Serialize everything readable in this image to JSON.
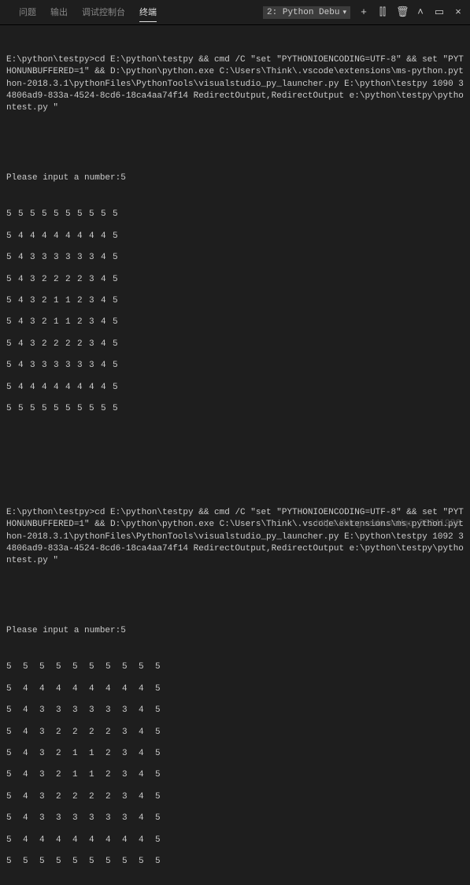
{
  "header": {
    "tabs": {
      "problems": "问题",
      "output": "输出",
      "debug_console": "调试控制台",
      "terminal": "终端"
    },
    "active_tab": "terminal",
    "dropdown_label": "2: Python Debu",
    "icons": {
      "plus": "+",
      "split": "⫿⫿",
      "trash": "🗑",
      "up": "˄",
      "maximize": "▭",
      "close": "×"
    }
  },
  "run1": {
    "cmd_line1": "E:\\python\\testpy>cd E:\\python\\testpy && cmd /C \"set \"PYTHONIOENCODING=UTF-8\" && set \"PYTHONUNBUFFERED=1\" && D:\\python\\python.exe C:\\Users\\Think\\.vscode\\extensions\\ms-python.python-2018.3.1\\pythonFiles\\PythonTools\\visualstudio_py_launcher.py E:\\python\\testpy 1090 34806ad9-833a-4524-8cd6-18ca4aa74f14 RedirectOutput,RedirectOutput e:\\python\\testpy\\pythontest.py \"",
    "prompt": "Please input a number:5",
    "rows": [
      [
        "5",
        "5",
        "5",
        "5",
        "5",
        "5",
        "5",
        "5",
        "5",
        "5"
      ],
      [
        "5",
        "4",
        "4",
        "4",
        "4",
        "4",
        "4",
        "4",
        "4",
        "5"
      ],
      [
        "5",
        "4",
        "3",
        "3",
        "3",
        "3",
        "3",
        "3",
        "4",
        "5"
      ],
      [
        "5",
        "4",
        "3",
        "2",
        "2",
        "2",
        "2",
        "3",
        "4",
        "5"
      ],
      [
        "5",
        "4",
        "3",
        "2",
        "1",
        "1",
        "2",
        "3",
        "4",
        "5"
      ],
      [
        "5",
        "4",
        "3",
        "2",
        "1",
        "1",
        "2",
        "3",
        "4",
        "5"
      ],
      [
        "5",
        "4",
        "3",
        "2",
        "2",
        "2",
        "2",
        "3",
        "4",
        "5"
      ],
      [
        "5",
        "4",
        "3",
        "3",
        "3",
        "3",
        "3",
        "3",
        "4",
        "5"
      ],
      [
        "5",
        "4",
        "4",
        "4",
        "4",
        "4",
        "4",
        "4",
        "4",
        "5"
      ],
      [
        "5",
        "5",
        "5",
        "5",
        "5",
        "5",
        "5",
        "5",
        "5",
        "5"
      ]
    ]
  },
  "run2": {
    "cmd_line1": "E:\\python\\testpy>cd E:\\python\\testpy && cmd /C \"set \"PYTHONIOENCODING=UTF-8\" && set \"PYTHONUNBUFFERED=1\" && D:\\python\\python.exe C:\\Users\\Think\\.vscode\\extensions\\ms-python.python-2018.3.1\\pythonFiles\\PythonTools\\visualstudio_py_launcher.py E:\\python\\testpy 1092 34806ad9-833a-4524-8cd6-18ca4aa74f14 RedirectOutput,RedirectOutput e:\\python\\testpy\\pythontest.py \"",
    "prompt": "Please input a number:5",
    "rows": [
      [
        "5",
        "5",
        "5",
        "5",
        "5",
        "5",
        "5",
        "5",
        "5",
        "5"
      ],
      [
        "5",
        "4",
        "4",
        "4",
        "4",
        "4",
        "4",
        "4",
        "4",
        "5"
      ],
      [
        "5",
        "4",
        "3",
        "3",
        "3",
        "3",
        "3",
        "3",
        "4",
        "5"
      ],
      [
        "5",
        "4",
        "3",
        "2",
        "2",
        "2",
        "2",
        "3",
        "4",
        "5"
      ],
      [
        "5",
        "4",
        "3",
        "2",
        "1",
        "1",
        "2",
        "3",
        "4",
        "5"
      ],
      [
        "5",
        "4",
        "3",
        "2",
        "1",
        "1",
        "2",
        "3",
        "4",
        "5"
      ],
      [
        "5",
        "4",
        "3",
        "2",
        "2",
        "2",
        "2",
        "3",
        "4",
        "5"
      ],
      [
        "5",
        "4",
        "3",
        "3",
        "3",
        "3",
        "3",
        "3",
        "4",
        "5"
      ],
      [
        "5",
        "4",
        "4",
        "4",
        "4",
        "4",
        "4",
        "4",
        "4",
        "5"
      ],
      [
        "5",
        "5",
        "5",
        "5",
        "5",
        "5",
        "5",
        "5",
        "5",
        "5"
      ]
    ]
  },
  "watermark": "https://blog.csdn.net/qq_36241986"
}
